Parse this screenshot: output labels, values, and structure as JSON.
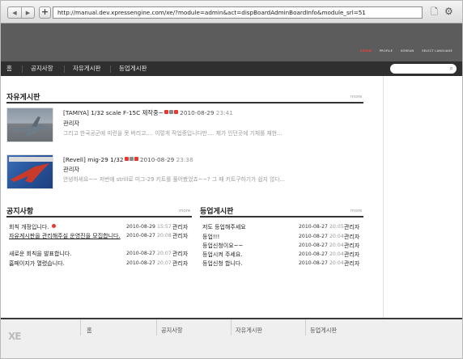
{
  "browser": {
    "url": "http://manual.dev.xpressengine.com/xe/?module=admin&act=dispBoardAdminBoardInfo&module_srl=51",
    "back_icon": "◀",
    "forward_icon": "▶",
    "add_icon": "+",
    "page_icon": "🗋",
    "gear_icon": "⚙"
  },
  "header": {
    "top_links": [
      "LOGIN",
      "PROFILE",
      "KOREAN",
      "SELECT LANGUAGE"
    ]
  },
  "gnb": {
    "items": [
      "홈",
      "공지사항",
      "자유게시판",
      "등업게시판"
    ],
    "search_icon": "⌕"
  },
  "free_board": {
    "title": "자유게시판",
    "more": "more",
    "posts": [
      {
        "title": "[TAMIYA] 1/32 scale F-15C 제작중~",
        "date": "2010-08-29",
        "time": "23:41",
        "author": "관리자",
        "excerpt": "그리고 한국공군에 미련을 못 버리고.... 이렇게 작업중입니다만.... 제가 인던곳에 기체를 재현..."
      },
      {
        "title": "[Revell] mig-29 1/32",
        "date": "2010-08-29",
        "time": "23:38",
        "author": "관리자",
        "excerpt": "안녕하세요~~ 저번에 strill로 미그-29 키트를 풀어봤었죠~~? 그 때 키트구하기가 쉽지 않다..."
      }
    ]
  },
  "notice": {
    "title": "공지사항",
    "more": "more",
    "rows": [
      {
        "title": "회칙 개정입니다.",
        "date": "2010-08-29",
        "time": "15:57",
        "author": "관리자"
      },
      {
        "title": "자유게시판을 관리해주실 운영진을 모집합니다.",
        "date": "2010-08-27",
        "time": "20:08",
        "author": "관리자"
      },
      {
        "title": "새로운 회칙을 발표합니다.",
        "date": "2010-08-27",
        "time": "20:07",
        "author": "관리자"
      },
      {
        "title": "홈페이지가 열렸습니다.",
        "date": "2010-08-27",
        "time": "20:07",
        "author": "관리자"
      }
    ]
  },
  "level_board": {
    "title": "등업게시판",
    "more": "more",
    "rows": [
      {
        "title": "저도 등업해주세요",
        "date": "2010-08-27",
        "time": "20:05",
        "author": "관리자"
      },
      {
        "title": "등업!!!",
        "date": "2010-08-27",
        "time": "20:04",
        "author": "관리자"
      },
      {
        "title": "등업신청이요~~",
        "date": "2010-08-27",
        "time": "20:04",
        "author": "관리자"
      },
      {
        "title": "등업시켜 주세요.",
        "date": "2010-08-27",
        "time": "20:04",
        "author": "관리자"
      },
      {
        "title": "등업신청 합니다.",
        "date": "2010-08-27",
        "time": "20:04",
        "author": "관리자"
      }
    ]
  },
  "footer": {
    "logo": "XE",
    "links": [
      "홈",
      "공지사항",
      "자유게시판",
      "등업게시판"
    ]
  }
}
